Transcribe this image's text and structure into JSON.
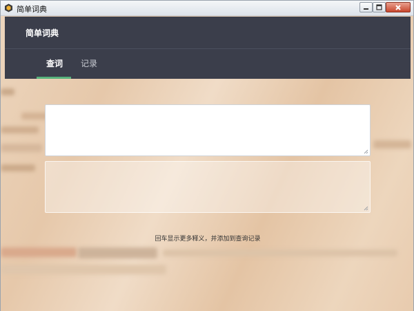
{
  "window": {
    "title": "简单词典"
  },
  "header": {
    "title": "简单词典"
  },
  "tabs": [
    {
      "label": "查词",
      "active": true
    },
    {
      "label": "记录",
      "active": false
    }
  ],
  "colors": {
    "header_bg": "#3b3e4b",
    "tab_indicator": "#57b37c"
  },
  "query": {
    "input_value": "",
    "result_value": ""
  },
  "hint": "回车显示更多释义，并添加到查询记录"
}
